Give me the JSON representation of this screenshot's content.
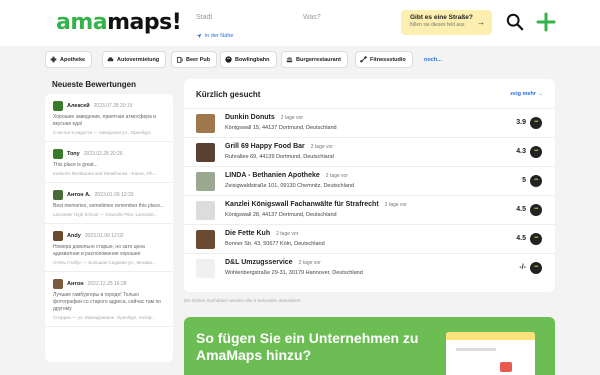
{
  "header": {
    "logo_a": "ama",
    "logo_b": "maps!",
    "stadt_label": "Stadt",
    "nahe_label": "in der Nähe",
    "was_label": "Was?",
    "promo_title": "Gibt es eine Straße?",
    "promo_sub": "füllen sie dieses feld aus",
    "promo_arrow": "→"
  },
  "chips": [
    {
      "label": "Apotheke",
      "icon": "pharmacy-icon"
    },
    {
      "label": "Autovermietung",
      "icon": "car-rental-icon"
    },
    {
      "label": "Beer Pub",
      "icon": "beer-icon"
    },
    {
      "label": "Bowlingbahn",
      "icon": "bowling-icon"
    },
    {
      "label": "Burgerrestaurant",
      "icon": "burger-icon"
    },
    {
      "label": "Fitnessstudio",
      "icon": "fitness-icon"
    }
  ],
  "noch_label": "noch...",
  "reviews_title": "Neueste Bewertungen",
  "reviews": [
    {
      "name": "Алексей",
      "date": "2023.07.28 20:15",
      "text": "Хорошее заведение, приятная атмосфера и вкусная еда!",
      "source": "Счастье в радости — Заводская ул., Оренбург...",
      "color": "#3a7a2a"
    },
    {
      "name": "Tony",
      "date": "2023.02.28 20:26",
      "text": "This place is great...",
      "source": "Karlsons Restaurant and Steakhouse - Kanon, Ph...",
      "color": "#3a7a2a"
    },
    {
      "name": "Антон А.",
      "date": "2023.01.09 12:33",
      "text": "Best memories, sometimes remember this place...",
      "source": "Lancaster High School — Granville Pike, Lancaste...",
      "color": "#4a6a3a"
    },
    {
      "name": "Andy",
      "date": "2023.01.09 12:02",
      "text": "Номера довольно старые, но зато цена адекватная и расположение хорошее",
      "source": "Отель Глобус — Большая Садовая ул., Москва...",
      "color": "#6a4a2a"
    },
    {
      "name": "Антон",
      "date": "2022.12.25 16:28",
      "text": "Лучшие гамбургеры в городе! Только фотографии со старого адреса, сейчас там по другому",
      "source": "Спорриз — ул. Мажарриване, Оренбург, телеф...",
      "color": "#7a5a3a"
    }
  ],
  "card": {
    "title": "Kürzlich gesucht",
    "more": "zeig mehr →",
    "items": [
      {
        "name": "Dunkin Donuts",
        "ago": "2 tage vor",
        "addr": "Königswall 15, 44137 Dortmund, Deutschland",
        "score": "3.9",
        "thumb": "#a07850"
      },
      {
        "name": "Grill 69 Happy Food Bar",
        "ago": "2 tage vor",
        "addr": "Ruhrallee 69, 44139 Dortmund, Deutschland",
        "score": "4.3",
        "thumb": "#5a4030"
      },
      {
        "name": "LINDA - Bethanien Apotheke",
        "ago": "2 tage vor",
        "addr": "Zeisigwaldstraße 101, 09130 Chemnitz, Deutschland",
        "score": "5",
        "thumb": "#9aa890"
      },
      {
        "name": "Kanzlei Königswall Fachanwälte für Strafrecht",
        "ago": "2 tage vor",
        "addr": "Königswall 28, 44137 Dortmund, Deutschland",
        "score": "4.5",
        "thumb": "#dcdcdc"
      },
      {
        "name": "Die Fette Kuh",
        "ago": "2 tage vor",
        "addr": "Bonner Str. 43, 50677 Köln, Deutschland",
        "score": "4.5",
        "thumb": "#6a4a30"
      },
      {
        "name": "D&L Umzugsservice",
        "ago": "2 tage vor",
        "addr": "Wohlenbergstraße 29-31, 30179 Hannover, Deutschland",
        "score": "-/-",
        "thumb": "#f0f0f0"
      }
    ]
  },
  "footnote": "Die letzten Suchdaten werden alle 5 Sekunden aktualisiert.",
  "banner_title": "So fügen Sie ein Unternehmen zu AmaMaps hinzu?",
  "colors": {
    "brand_green": "#35b24a",
    "banner_green": "#6cbd54",
    "link_blue": "#2a6fdb"
  }
}
